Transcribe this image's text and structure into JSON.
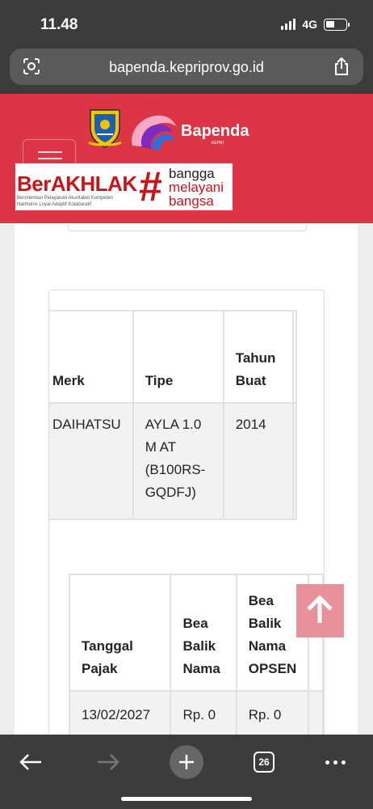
{
  "status_bar": {
    "time": "11.48",
    "network": "4G"
  },
  "browser": {
    "url": "bapenda.kepriprov.go.id",
    "tab_count": "26"
  },
  "header": {
    "logo_text": "Bapenda",
    "banner": {
      "title": "BerAKHLAK",
      "tagline_line1": "Berorientasi Pelayanan Akuntabel Kompeten",
      "tagline_line2": "Harmonis Loyal Adaptif Kolaboratif",
      "slogan_word1": "bangga",
      "slogan_word2": "melayani",
      "slogan_word3": "bangsa"
    }
  },
  "vehicle_table": {
    "headers": [
      "Merk",
      "Tipe",
      "Tahun Buat"
    ],
    "row": [
      "DAIHATSU",
      "AYLA 1.0 M AT (B100RS-GQDFJ)",
      "2014"
    ]
  },
  "tax_table": {
    "headers": [
      "Tanggal Pajak",
      "Bea Balik Nama",
      "Bea Balik Nama OPSEN"
    ],
    "row": [
      "13/02/2027",
      "Rp. 0",
      "Rp. 0"
    ]
  },
  "colors": {
    "header_red": "#dc3545",
    "browser_chrome": "#3c3c3c",
    "scroll_top_button": "#e8919a"
  }
}
